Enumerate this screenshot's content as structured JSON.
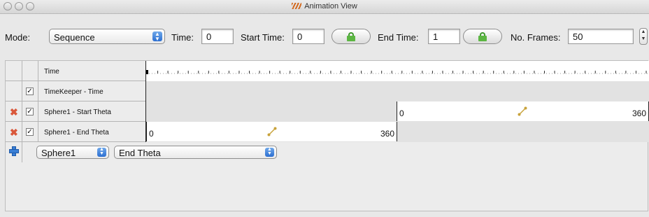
{
  "window": {
    "title": "Animation View",
    "logo_icon": "paraview-logo-icon"
  },
  "toolbar": {
    "mode_label": "Mode:",
    "mode_value": "Sequence",
    "time_label": "Time:",
    "time_value": "0",
    "start_time_label": "Start Time:",
    "start_time_value": "0",
    "end_time_label": "End Time:",
    "end_time_value": "1",
    "frames_label": "No. Frames:",
    "frames_value": "50"
  },
  "tracks": [
    {
      "label": "Time",
      "has_delete": false,
      "has_check": false
    },
    {
      "label": "TimeKeeper - Time",
      "has_delete": false,
      "has_check": true
    },
    {
      "label": "Sphere1 - Start Theta",
      "has_delete": true,
      "has_check": true,
      "keyframe_start": "0",
      "keyframe_end": "360"
    },
    {
      "label": "Sphere1 - End Theta",
      "has_delete": true,
      "has_check": true,
      "keyframe_start": "0",
      "keyframe_end": "360"
    }
  ],
  "add_row": {
    "source_value": "Sphere1",
    "property_value": "End Theta"
  },
  "colors": {
    "delete": "#d9573a",
    "add": "#3a7fd6",
    "lock": "#5cb642",
    "interp": "#c8a23a"
  }
}
